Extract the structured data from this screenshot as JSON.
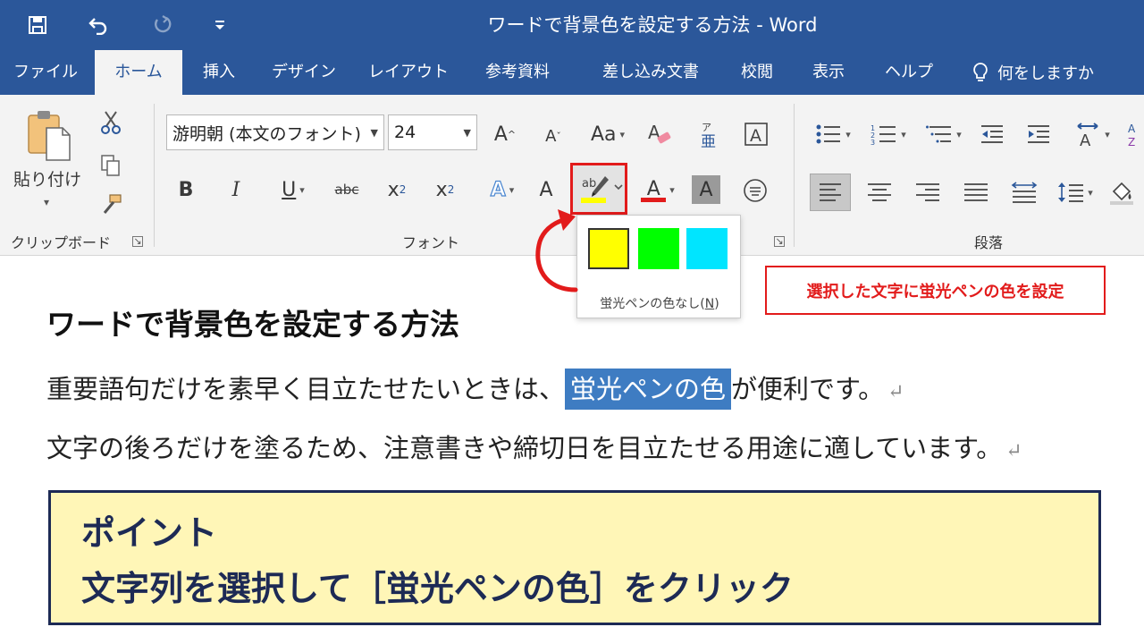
{
  "window": {
    "title": "ワードで背景色を設定する方法  -  Word"
  },
  "tabs": [
    "ファイル",
    "ホーム",
    "挿入",
    "デザイン",
    "レイアウト",
    "参考資料",
    "差し込み文書",
    "校閲",
    "表示",
    "ヘルプ"
  ],
  "active_tab": "ホーム",
  "tell_me": "何をしますか",
  "clipboard": {
    "paste_label": "貼り付け",
    "group_label": "クリップボード"
  },
  "font": {
    "name": "游明朝 (本文のフォント)",
    "size": "24",
    "group_label": "フォント",
    "labels": {
      "grow": "A",
      "shrink": "A",
      "case": "Aa",
      "bold": "B",
      "italic": "I",
      "underline": "U",
      "strike": "abc",
      "subscript_base": "x",
      "subscript": "2",
      "superscript_base": "x",
      "superscript": "2",
      "effects": "A",
      "shading": "A",
      "font_color": "A",
      "char_shading": "A",
      "clear_format": "A",
      "phonetic": "亜",
      "border": "A",
      "enclose": "字"
    }
  },
  "paragraph": {
    "group_label": "段落"
  },
  "highlight_palette": {
    "colors": [
      "#ffff00",
      "#00ff00",
      "#00e5ff"
    ],
    "no_color_label": "蛍光ペンの色なし(N)",
    "no_color_text": "蛍光ペンの色なし(",
    "no_color_key": "N",
    "no_color_close": ")"
  },
  "callout": "選択した文字に蛍光ペンの色を設定",
  "document": {
    "heading": "ワードで背景色を設定する方法",
    "para1_before": "重要語句だけを素早く目立たせたいときは、",
    "para1_highlight": "蛍光ペンの色",
    "para1_after": "が便利です。",
    "para2": "文字の後ろだけを塗るため、注意書きや締切日を目立たせる用途に適しています。",
    "paragraph_mark": "↵",
    "point_title": "ポイント",
    "point_body": "文字列を選択して［蛍光ペンの色］をクリック"
  },
  "colors": {
    "ribbon_blue": "#2b579a",
    "accent_red": "#e21b1b",
    "selection_blue": "#3e7cc2",
    "point_bg": "#fff6b7",
    "point_border": "#1d2a55"
  }
}
